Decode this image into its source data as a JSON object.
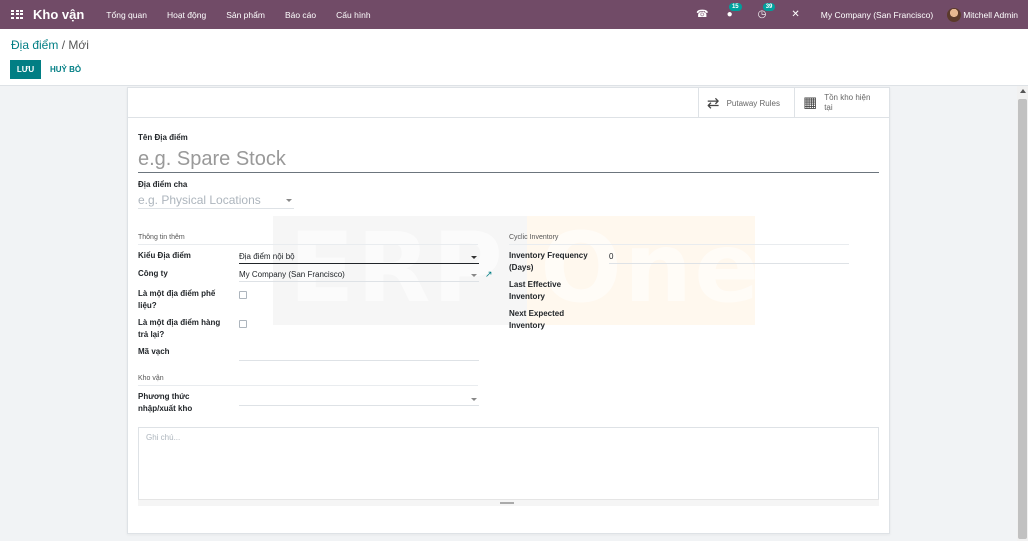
{
  "navbar": {
    "app_name": "Kho vận",
    "menu": [
      "Tổng quan",
      "Hoạt động",
      "Sản phẩm",
      "Báo cáo",
      "Cấu hình"
    ],
    "phone_icon": "☎",
    "messages_icon": "●",
    "messages_count": "15",
    "activities_icon": "◷",
    "activities_count": "39",
    "close_icon": "✕",
    "company": "My Company (San Francisco)",
    "user": "Mitchell Admin"
  },
  "breadcrumb": {
    "parent": "Địa điểm",
    "separator": " / ",
    "current": "Mới"
  },
  "actions": {
    "save": "LƯU",
    "discard": "HUỶ BỎ"
  },
  "smart_buttons": {
    "putaway_icon": "⇄",
    "putaway": "Putaway Rules",
    "onhand_icon": "▦",
    "onhand_line1": "Tồn kho hiện",
    "onhand_line2": "tại"
  },
  "watermark": "ERP One",
  "form": {
    "name_label": "Tên Địa điểm",
    "name_placeholder": "e.g. Spare Stock",
    "parent_label": "Địa điểm cha",
    "parent_placeholder": "e.g. Physical Locations",
    "additional_info": {
      "title": "Thông tin thêm",
      "location_type_label": "Kiểu Địa điểm",
      "location_type_value": "Địa điểm nội bộ",
      "company_label": "Công ty",
      "company_value": "My Company (San Francisco)",
      "ext_link_icon": "↗",
      "scrap_label_1": "Là một địa điểm phế",
      "scrap_label_2": "liệu?",
      "return_label_1": "Là một địa điểm hàng",
      "return_label_2": "trả lại?",
      "barcode_label": "Mã vạch"
    },
    "cyclic": {
      "title": "Cyclic Inventory",
      "frequency_label_1": "Inventory Frequency",
      "frequency_label_2": "(Days)",
      "frequency_value": "0",
      "last_label_1": "Last Effective",
      "last_label_2": "Inventory",
      "next_label_1": "Next Expected",
      "next_label_2": "Inventory"
    },
    "logistics": {
      "title": "Kho vận",
      "removal_label_1": "Phương thức",
      "removal_label_2": "nhập/xuất kho"
    },
    "notes_placeholder": "Ghi chú..."
  }
}
